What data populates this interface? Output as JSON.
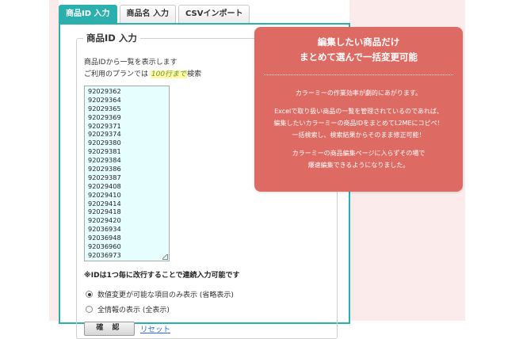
{
  "tabs": [
    {
      "label": "商品ID 入力",
      "active": true
    },
    {
      "label": "商品名 入力",
      "active": false
    },
    {
      "label": "CSVインポート",
      "active": false
    }
  ],
  "form": {
    "legend": "商品ID 入力",
    "description_line1": "商品IDから一覧を表示します",
    "description_line2_prefix": "ご利用のプランでは",
    "description_line2_highlight": "100行まで",
    "description_line2_suffix": "検索",
    "ids": [
      "92029362",
      "92029364",
      "92029365",
      "92029369",
      "92029371",
      "92029374",
      "92029380",
      "92029381",
      "92029384",
      "92029386",
      "92029387",
      "92029408",
      "92029410",
      "92029414",
      "92029418",
      "92029420",
      "92036934",
      "92036948",
      "92036960",
      "92036973"
    ],
    "note": "※IDは1つ毎に改行することで連続入力可能です",
    "radio_options": [
      {
        "label": "数値変更が可能な項目のみ表示 (省略表示)",
        "checked": true
      },
      {
        "label": "全情報の表示 (全表示)",
        "checked": false
      }
    ],
    "confirm_label": "確 認",
    "reset_label": "リセット"
  },
  "callout": {
    "title_line1": "編集したい商品だけ",
    "title_line2": "まとめて選んで一括変更可能",
    "body": [
      "カラーミーの作業効率が劇的にあがります。",
      "",
      "Excelで取り扱い商品の一覧を管理されているのであれば、",
      "編集したいカラーミーの商品IDをまとめてL2MEにコピペ！",
      "一括検索し、検索結果からそのまま修正可能！",
      "",
      "カラーミーの商品編集ページに入らずその場で",
      "爆速編集できるようになりました。"
    ]
  },
  "colors": {
    "accent": "#2bb0ae",
    "callout": "#de6b63",
    "highlight_text": "#6a9a2a",
    "textarea_bg": "#e6fefe"
  }
}
